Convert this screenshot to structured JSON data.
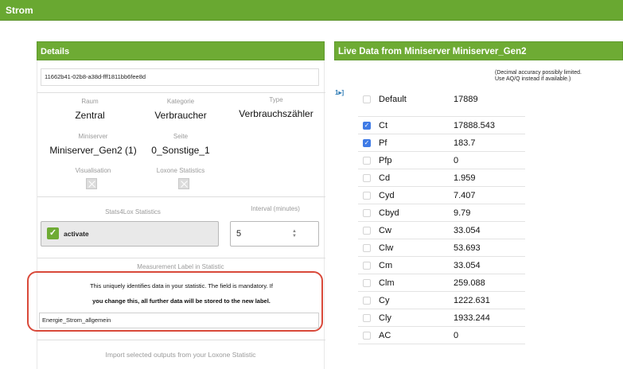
{
  "topbar": {
    "title": "Strom"
  },
  "details": {
    "header": "Details",
    "id": "11662b41-02b8-a38d-fff1811bb6fee8d",
    "raum": {
      "label": "Raum",
      "value": "Zentral"
    },
    "kategorie": {
      "label": "Kategorie",
      "value": "Verbraucher"
    },
    "type": {
      "label": "Type",
      "value": "Verbrauchszähler"
    },
    "miniserver": {
      "label": "Miniserver",
      "value": "Miniserver_Gen2 (1)"
    },
    "seite": {
      "label": "Seite",
      "value": "0_Sonstige_1"
    },
    "visualisation_label": "Visualisation",
    "loxone_stats_label": "Loxone Statistics",
    "stats4lox_label": "Stats4Lox Statistics",
    "activate_label": "activate",
    "interval_label": "Interval (minutes)",
    "interval_value": "5",
    "measurement_label_title": "Measurement Label in Statistic",
    "mandatory_text": "This uniquely identifies data in your statistic. The field is mandatory. If",
    "mandatory_bold": "you change this, all further data will be stored to the new label.",
    "measurement_label_value": "Energie_Strom_allgemein",
    "import_text": "Import selected outputs from your Loxone Statistic"
  },
  "live": {
    "header": "Live Data from Miniserver Miniserver_Gen2",
    "expand_icon": "1▸]",
    "default_note": "(Decimal accuracy possibly limited. Use AQ/Q instead if available.)",
    "rows": [
      {
        "name": "Default",
        "value": "17889",
        "checked": false
      },
      {
        "name": "Ct",
        "value": "17888.543",
        "checked": true
      },
      {
        "name": "Pf",
        "value": "183.7",
        "checked": true
      },
      {
        "name": "Pfp",
        "value": "0",
        "checked": false
      },
      {
        "name": "Cd",
        "value": "1.959",
        "checked": false
      },
      {
        "name": "Cyd",
        "value": "7.407",
        "checked": false
      },
      {
        "name": "Cbyd",
        "value": "9.79",
        "checked": false
      },
      {
        "name": "Cw",
        "value": "33.054",
        "checked": false
      },
      {
        "name": "Clw",
        "value": "53.693",
        "checked": false
      },
      {
        "name": "Cm",
        "value": "33.054",
        "checked": false
      },
      {
        "name": "Clm",
        "value": "259.088",
        "checked": false
      },
      {
        "name": "Cy",
        "value": "1222.631",
        "checked": false
      },
      {
        "name": "Cly",
        "value": "1933.244",
        "checked": false
      },
      {
        "name": "AC",
        "value": "0",
        "checked": false
      }
    ]
  }
}
